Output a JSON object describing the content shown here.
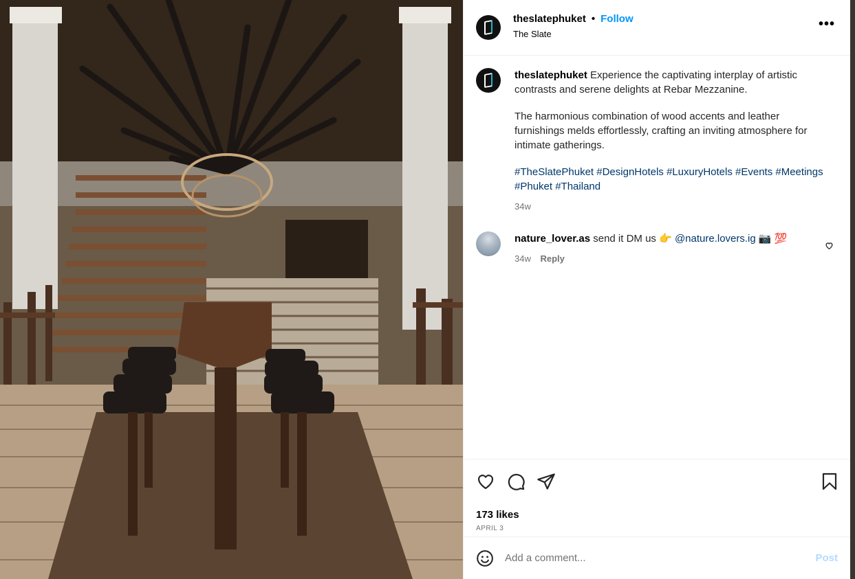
{
  "header": {
    "username": "theslatephuket",
    "separator": "•",
    "follow_label": "Follow",
    "location": "The Slate",
    "more_label": "•••"
  },
  "caption": {
    "username": "theslatephuket",
    "paragraph1": "Experience the captivating interplay of artistic contrasts and serene delights at Rebar Mezzanine.",
    "paragraph2": "The harmonious combination of wood accents and leather furnishings melds effortlessly, crafting an inviting atmosphere for intimate gatherings.",
    "hashtags": "#TheSlatePhuket #DesignHotels #LuxuryHotels #Events #Meetings #Phuket #Thailand",
    "time": "34w"
  },
  "comment": {
    "username": "nature_lover.as",
    "text": "send it DM us 👉",
    "mention": "@nature.lovers.ig",
    "emoji": "📷 💯",
    "time": "34w",
    "reply_label": "Reply"
  },
  "actions": {
    "likes": "173 likes",
    "date": "APRIL 3"
  },
  "add_comment": {
    "placeholder": "Add a comment...",
    "post_label": "Post"
  },
  "icons": {
    "like": "heart-icon",
    "comment": "comment-icon",
    "share": "share-icon",
    "save": "bookmark-icon",
    "emoji": "emoji-icon",
    "comment_like": "heart-icon"
  },
  "colors": {
    "follow": "#0095f6",
    "hashtag": "#00376b",
    "post_disabled": "#b3dbff"
  }
}
